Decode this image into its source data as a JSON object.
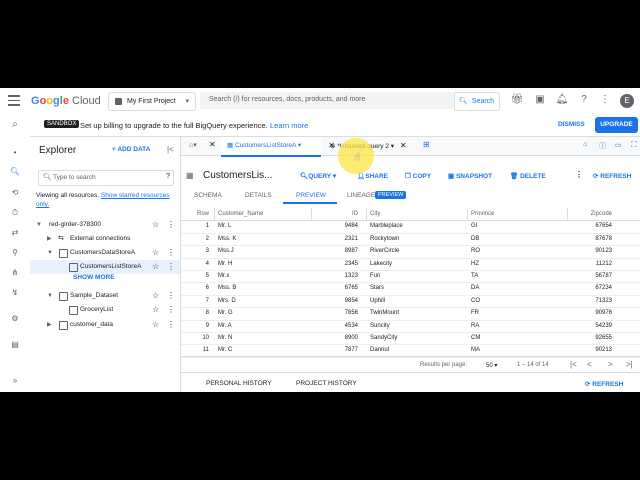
{
  "app": {
    "logo": {
      "g1": "G",
      "g2": "o",
      "g3": "o",
      "g4": "g",
      "g5": "l",
      "g6": "e",
      "cloud": "Cloud"
    }
  },
  "topbar": {
    "project": "My First Project",
    "search_placeholder": "Search (/) for resources, docs, products, and more",
    "search_button": "Search",
    "avatar_letter": "E"
  },
  "banner": {
    "badge": "SANDBOX",
    "text": "Set up billing to upgrade to the full BigQuery experience.",
    "link": "Learn more",
    "dismiss": "DISMISS",
    "upgrade": "UPGRADE"
  },
  "explorer": {
    "title": "Explorer",
    "add_data": "+ ADD DATA",
    "search_placeholder": "Type to search",
    "viewing_text": "Viewing all resources.",
    "viewing_link": "Show starred resources only.",
    "tree": [
      {
        "label": "red-girder-378300"
      },
      {
        "label": "External connections"
      },
      {
        "label": "CustomersDataStoreA"
      },
      {
        "label": "CustomersListStoreA"
      },
      {
        "label": "Sample_Dataset"
      },
      {
        "label": "GroceryList"
      },
      {
        "label": "customer_data"
      }
    ],
    "show_more": "SHOW MORE"
  },
  "tabs": [
    {
      "label": "CustomersListStoreA"
    },
    {
      "label": "*Unsaved query 2"
    }
  ],
  "table_view": {
    "title": "CustomersLis...",
    "actions": {
      "query": "QUERY",
      "share": "SHARE",
      "copy": "COPY",
      "snapshot": "SNAPSHOT",
      "delete": "DELETE",
      "refresh": "REFRESH"
    },
    "subtabs": {
      "schema": "SCHEMA",
      "details": "DETAILS",
      "preview": "PREVIEW",
      "lineage": "LINEAGE"
    },
    "preview_badge": "PREVIEW"
  },
  "grid": {
    "headers": {
      "row": "Row",
      "name": "Customer_Name",
      "id": "ID",
      "city": "City",
      "province": "Province",
      "zip": "Zipcode"
    },
    "rows": [
      {
        "row": "1",
        "name": "Mr. L",
        "id": "9484",
        "city": "Marbleplace",
        "province": "GI",
        "zip": "67654"
      },
      {
        "row": "2",
        "name": "Mss. K",
        "id": "2321",
        "city": "Rockytown",
        "province": "DB",
        "zip": "87678"
      },
      {
        "row": "3",
        "name": "Mss.J",
        "id": "8987",
        "city": "RiverCircle",
        "province": "RO",
        "zip": "90123"
      },
      {
        "row": "4",
        "name": "Mr. H",
        "id": "2345",
        "city": "Lakecity",
        "province": "HZ",
        "zip": "11212"
      },
      {
        "row": "5",
        "name": "Mr.x",
        "id": "1323",
        "city": "Fun",
        "province": "TA",
        "zip": "56787"
      },
      {
        "row": "6",
        "name": "Mss. B",
        "id": "6765",
        "city": "Stars",
        "province": "DA",
        "zip": "67234"
      },
      {
        "row": "7",
        "name": "Mrs. D",
        "id": "9854",
        "city": "Uphill",
        "province": "CO",
        "zip": "71323"
      },
      {
        "row": "8",
        "name": "Mr. G",
        "id": "7856",
        "city": "TwinMount",
        "province": "FR",
        "zip": "90976"
      },
      {
        "row": "9",
        "name": "Mr. A",
        "id": "4534",
        "city": "Suncity",
        "province": "RA",
        "zip": "54239"
      },
      {
        "row": "10",
        "name": "Mr. N",
        "id": "8900",
        "city": "SandyCity",
        "province": "CM",
        "zip": "92655"
      },
      {
        "row": "11",
        "name": "Mr. C",
        "id": "7877",
        "city": "Dannul",
        "province": "MA",
        "zip": "90213"
      }
    ]
  },
  "pager": {
    "label": "Results per page:",
    "per_page": "50",
    "range": "1 – 14 of 14"
  },
  "history": {
    "personal": "PERSONAL HISTORY",
    "project": "PROJECT HISTORY",
    "refresh": "REFRESH"
  }
}
